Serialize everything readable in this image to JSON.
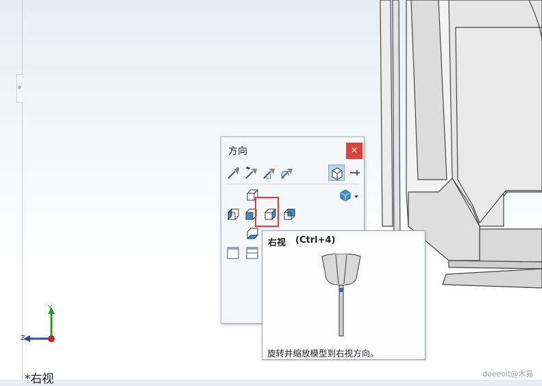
{
  "panel": {
    "title": "方向",
    "close_glyph": "×",
    "toolbar_icons": [
      "view-selector-icon",
      "new-view-icon",
      "update-standard-views-icon",
      "reset-standard-views-icon",
      "view-cube-icon",
      "pin-icon"
    ]
  },
  "tooltip": {
    "title": "右视",
    "shortcut": "(Ctrl+4)",
    "description": "旋转并缩放模型到右视方向。"
  },
  "viewport": {
    "view_label": "*右视",
    "axis_y": "Y",
    "axis_z": "Z"
  },
  "watermark": "deeeoit@木易",
  "colors": {
    "close_button": "#d9453a",
    "highlight_border": "#e23a3a",
    "cube_face": "#3e8fd0",
    "pinned_bg": "#bcd6ee"
  }
}
